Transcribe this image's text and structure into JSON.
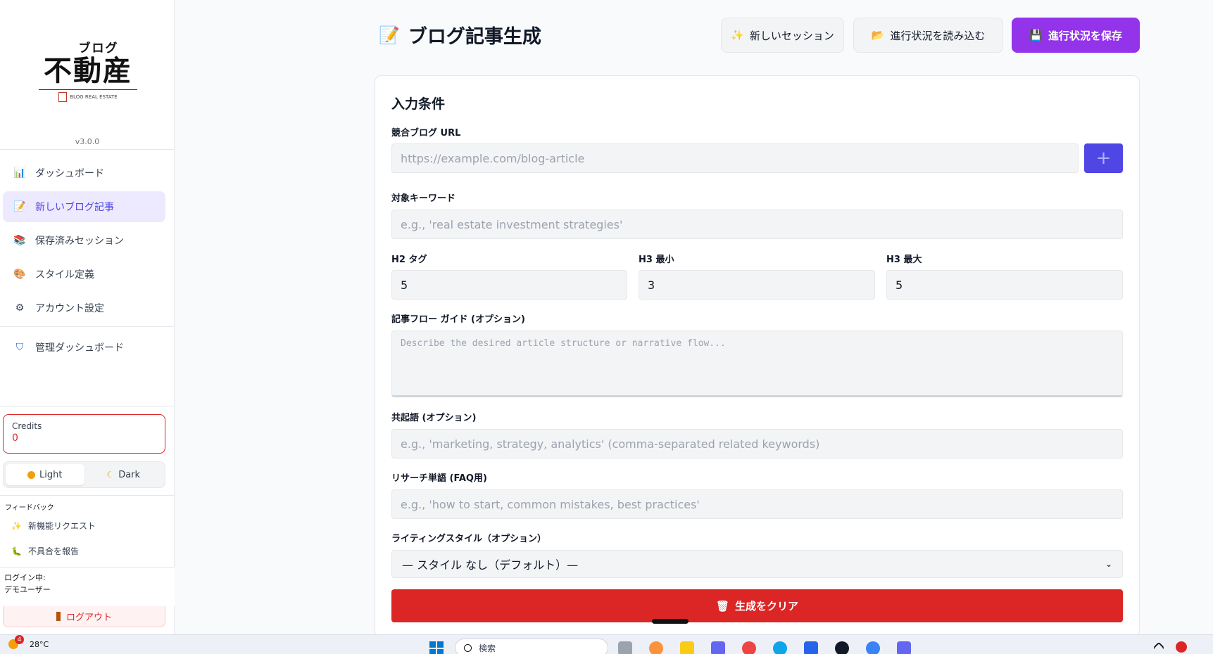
{
  "logo": {
    "kana": "ブログ",
    "kanji": "不動産",
    "sub": "BLOG REAL ESTATE"
  },
  "version": "v3.0.0",
  "sidebar": {
    "items": [
      {
        "label": "ダッシュボード",
        "icon": "bar-chart-icon"
      },
      {
        "label": "新しいブログ記事",
        "icon": "memo-icon",
        "active": true
      },
      {
        "label": "保存済みセッション",
        "icon": "books-icon"
      },
      {
        "label": "スタイル定義",
        "icon": "palette-icon"
      },
      {
        "label": "アカウント設定",
        "icon": "gear-icon"
      },
      {
        "label": "管理ダッシュボード",
        "icon": "shield-icon"
      }
    ],
    "credits": {
      "label": "Credits",
      "value": "0"
    },
    "theme": {
      "light": "Light",
      "dark": "Dark",
      "selected": "Light"
    },
    "feedback": {
      "title": "フィードバック",
      "items": [
        {
          "label": "新機能リクエスト",
          "icon": "sparkles-icon"
        },
        {
          "label": "不具合を報告",
          "icon": "bug-icon"
        }
      ]
    },
    "login": {
      "line1": "ログイン中:",
      "line2": "デモユーザー"
    },
    "logout": "ログアウト"
  },
  "header": {
    "title": "ブログ記事生成",
    "buttons": {
      "new_session": "新しいセッション",
      "load_progress": "進行状況を読み込む",
      "save_progress": "進行状況を保存"
    }
  },
  "form": {
    "section_title": "入力条件",
    "competitor_url": {
      "label": "競合ブログ URL",
      "placeholder": "https://example.com/blog-article",
      "add": "+"
    },
    "keyword": {
      "label": "対象キーワード",
      "placeholder": "e.g., 'real estate investment strategies'"
    },
    "h2": {
      "label": "H2 タグ",
      "value": "5"
    },
    "h3_min": {
      "label": "H3 最小",
      "value": "3"
    },
    "h3_max": {
      "label": "H3 最大",
      "value": "5"
    },
    "flow_guide": {
      "label": "記事フロー ガイド (オプション)",
      "placeholder": "Describe the desired article structure or narrative flow..."
    },
    "cooccur": {
      "label": "共起語 (オプション)",
      "placeholder": "e.g., 'marketing, strategy, analytics' (comma-separated related keywords)"
    },
    "research": {
      "label": "リサーチ単語 (FAQ用)",
      "placeholder": "e.g., 'how to start, common mistakes, best practices'"
    },
    "style": {
      "label": "ライティングスタイル（オプション）",
      "selected": "— スタイル なし（デフォルト）—"
    },
    "clear_button": "生成をクリア"
  },
  "taskbar": {
    "weather": {
      "temp": "28°C",
      "badge": "4"
    },
    "search_placeholder": "検索"
  },
  "colors": {
    "accent": "#4f46e5",
    "primary_button": "#9333ea",
    "danger": "#dc2626",
    "active_nav_bg": "#ede9fe"
  }
}
